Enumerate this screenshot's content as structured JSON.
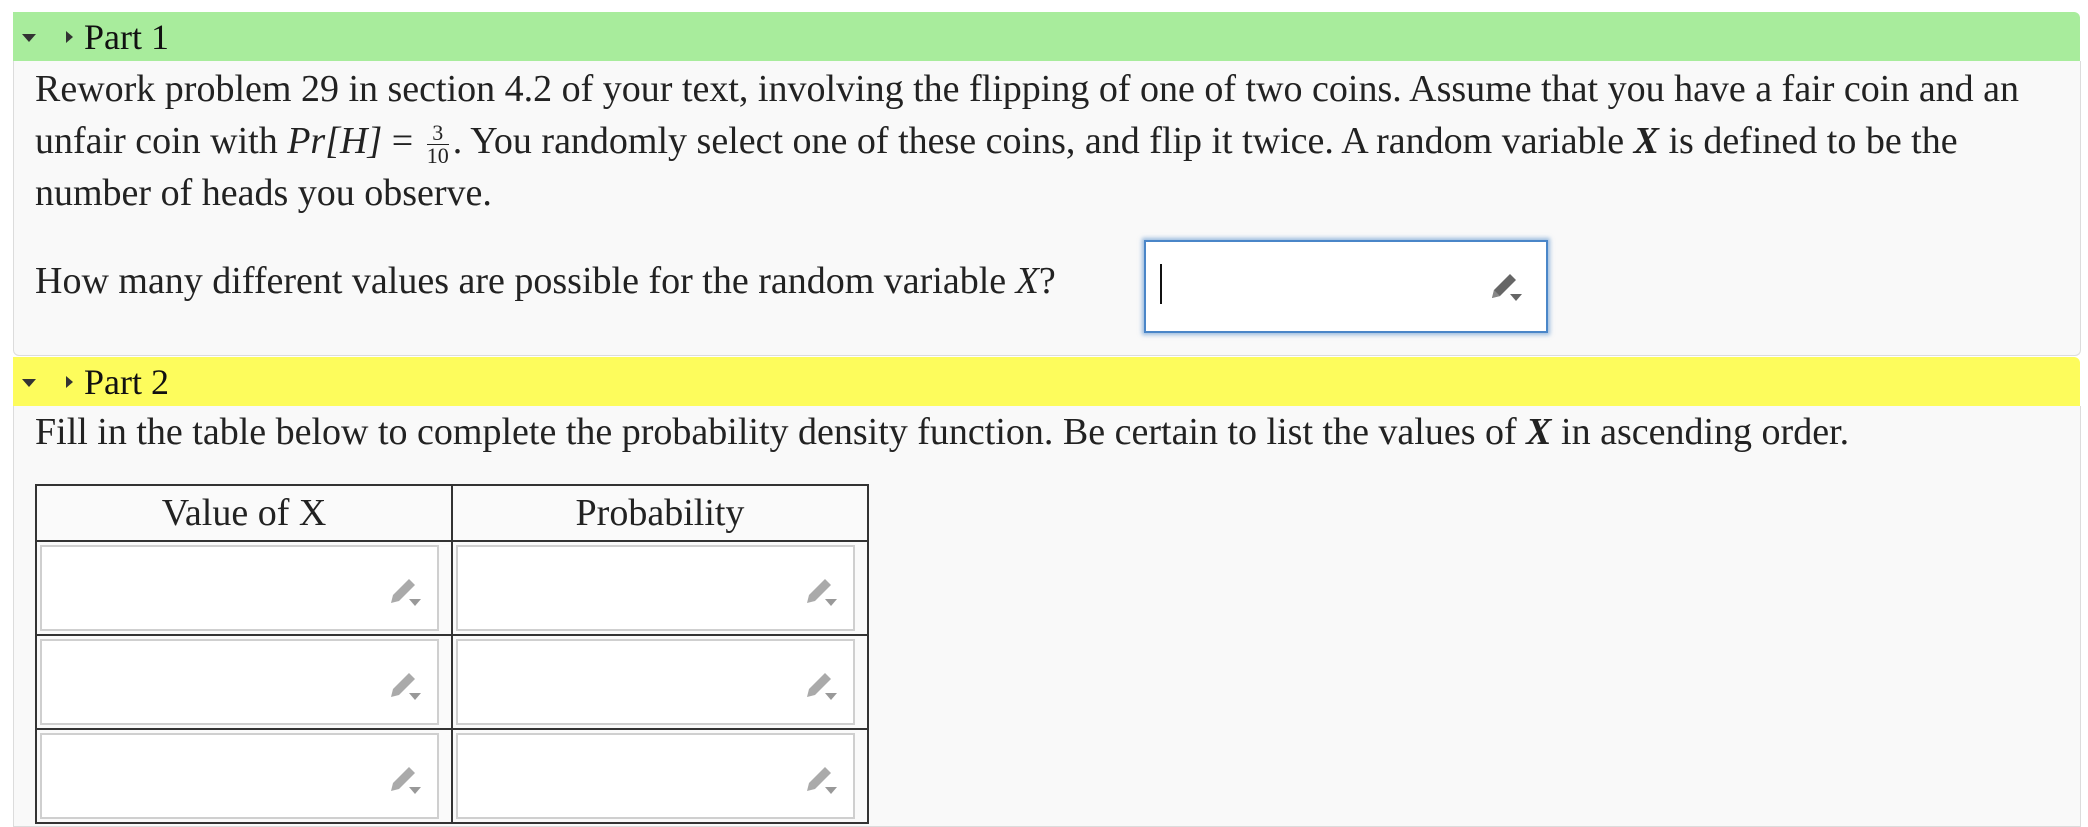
{
  "part1": {
    "title": "Part 1",
    "intro_a": "Rework problem 29 in section 4.2 of your text, involving the flipping of one of two coins. Assume that you have a fair coin and an unfair coin with ",
    "math_pr": "Pr[H]",
    "math_eq": " = ",
    "frac_num": "3",
    "frac_den": "10",
    "intro_b": ". You randomly select one of these coins, and flip it twice. A random variable ",
    "var_x": "X",
    "intro_c": " is defined to be the number of heads you observe.",
    "question_a": "How many different values are possible for the random variable ",
    "question_x": "X",
    "question_b": "?",
    "answer_value": ""
  },
  "part2": {
    "title": "Part 2",
    "instr_a": "Fill in the table below to complete the probability density function. Be certain to list the values of ",
    "instr_x": "X",
    "instr_b": " in ascending order.",
    "table": {
      "headers": [
        "Value of X",
        "Probability"
      ],
      "rows": [
        [
          "",
          ""
        ],
        [
          "",
          ""
        ],
        [
          "",
          ""
        ]
      ]
    }
  },
  "icons": {
    "toggle": "chevron-down-icon",
    "expand": "chevron-right-icon",
    "edit": "pencil-dropdown-icon"
  },
  "colors": {
    "part1_header": "#a8ec9c",
    "part2_header": "#fdfc5c",
    "focus_border": "#4a86c8"
  }
}
